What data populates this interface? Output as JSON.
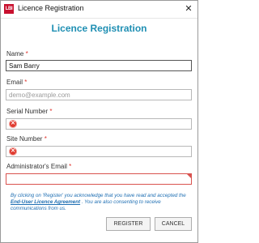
{
  "window": {
    "title": "Licence Registration",
    "app_icon_text": "LBI",
    "close_glyph": "✕"
  },
  "heading": "Licence Registration",
  "required_marker": "*",
  "fields": {
    "name": {
      "label": "Name",
      "value": "Sam Barry"
    },
    "email": {
      "label": "Email",
      "placeholder": "demo@example.com"
    },
    "serial": {
      "label": "Serial Number"
    },
    "site": {
      "label": "Site Number"
    },
    "admin_email": {
      "label": "Administrator's Email"
    }
  },
  "error_glyph": "✕",
  "consent": {
    "before": "By clicking on 'Register' you acknowledge that you have read and accepted the ",
    "link": "End-User Licence Agreement",
    "after": " . You are also consenting to receive communications from us."
  },
  "buttons": {
    "register": "REGISTER",
    "cancel": "CANCEL"
  }
}
